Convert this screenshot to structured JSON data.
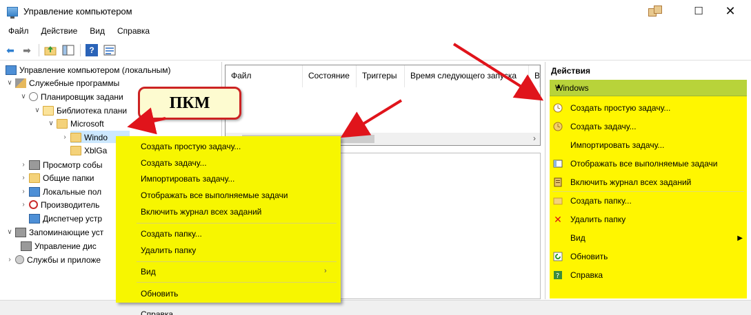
{
  "window": {
    "title": "Управление компьютером",
    "minimize": "—",
    "maximize": "☐",
    "close": "✕"
  },
  "menu": [
    "Файл",
    "Действие",
    "Вид",
    "Справка"
  ],
  "toolbar": {
    "help_glyph": "?"
  },
  "tree": {
    "items": [
      {
        "label": "Управление компьютером (локальным)"
      },
      {
        "label": "Служебные программы"
      },
      {
        "label": "Планировщик задани"
      },
      {
        "label": "Библиотека плани"
      },
      {
        "label": "Microsoft"
      },
      {
        "label": "Windo"
      },
      {
        "label": "XblGa"
      },
      {
        "label": "Просмотр собы"
      },
      {
        "label": "Общие папки"
      },
      {
        "label": "Локальные пол"
      },
      {
        "label": "Производитель"
      },
      {
        "label": "Диспетчер устр"
      },
      {
        "label": "Запоминающие уст"
      },
      {
        "label": "Управление дис"
      },
      {
        "label": "Службы и приложе"
      }
    ]
  },
  "grid": {
    "columns": [
      "Файл",
      "Состояние",
      "Триггеры",
      "Время следующего запуска",
      "В"
    ]
  },
  "actions": {
    "title": "Действия",
    "group": "Windows",
    "items": [
      {
        "label": "Создать простую задачу..."
      },
      {
        "label": "Создать задачу..."
      },
      {
        "label": "Импортировать задачу..."
      },
      {
        "label": "Отображать все выполняемые задачи"
      },
      {
        "label": "Включить журнал всех заданий"
      },
      {
        "label": "Создать папку..."
      },
      {
        "label": "Удалить папку"
      },
      {
        "label": "Вид"
      },
      {
        "label": "Обновить"
      },
      {
        "label": "Справка"
      }
    ]
  },
  "context_menu": {
    "items": [
      {
        "label": "Создать простую задачу..."
      },
      {
        "label": "Создать задачу..."
      },
      {
        "label": "Импортировать задачу..."
      },
      {
        "label": "Отображать все выполняемые задачи"
      },
      {
        "label": "Включить журнал всех заданий"
      },
      {
        "label": "Создать папку..."
      },
      {
        "label": "Удалить папку"
      },
      {
        "label": "Вид"
      },
      {
        "label": "Обновить"
      },
      {
        "label": "Справка"
      }
    ]
  },
  "callout": {
    "text": "ПКМ"
  },
  "colors": {
    "highlight": "#fff600",
    "arrow": "#e0141b",
    "windows_bar": "#b8d33a"
  }
}
